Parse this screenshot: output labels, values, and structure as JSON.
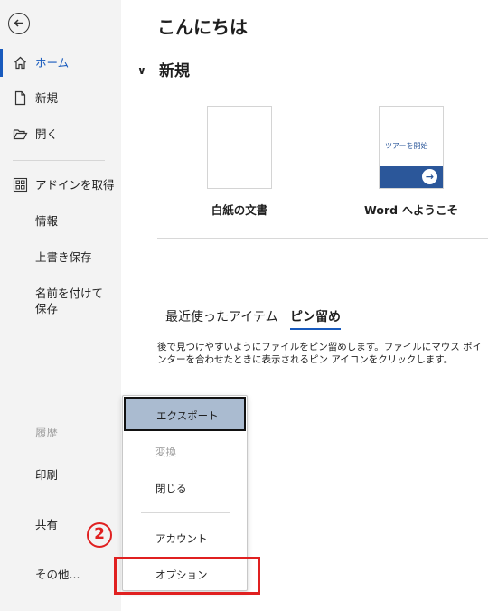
{
  "sidebar": {
    "items": [
      {
        "id": "home",
        "label": "ホーム"
      },
      {
        "id": "new",
        "label": "新規"
      },
      {
        "id": "open",
        "label": "開く"
      },
      {
        "id": "addins",
        "label": "アドインを取得"
      },
      {
        "id": "info",
        "label": "情報"
      },
      {
        "id": "save",
        "label": "上書き保存"
      },
      {
        "id": "saveas",
        "label": "名前を付けて保存"
      },
      {
        "id": "history",
        "label": "履歴"
      },
      {
        "id": "print",
        "label": "印刷"
      },
      {
        "id": "share",
        "label": "共有"
      },
      {
        "id": "more",
        "label": "その他..."
      }
    ]
  },
  "main": {
    "greeting": "こんにちは",
    "new_section": "新規",
    "templates": [
      {
        "label": "白紙の文書"
      },
      {
        "label": "Word へようこそ",
        "thumb_text": "ツアーを開始"
      }
    ],
    "tabs": [
      {
        "label": "最近使ったアイテム"
      },
      {
        "label": "ピン留め"
      }
    ],
    "pin_description": "後で見つけやすいようにファイルをピン留めします。ファイルにマウス ポインターを合わせたときに表示されるピン アイコンをクリックします。"
  },
  "popup": {
    "items": [
      {
        "label": "エクスポート"
      },
      {
        "label": "変換"
      },
      {
        "label": "閉じる"
      },
      {
        "label": "アカウント"
      },
      {
        "label": "オプション"
      }
    ]
  },
  "annotation": {
    "step_number": "2"
  },
  "colors": {
    "accent": "#185abd",
    "annotation": "#e02020",
    "highlight": "#aabbd0"
  }
}
